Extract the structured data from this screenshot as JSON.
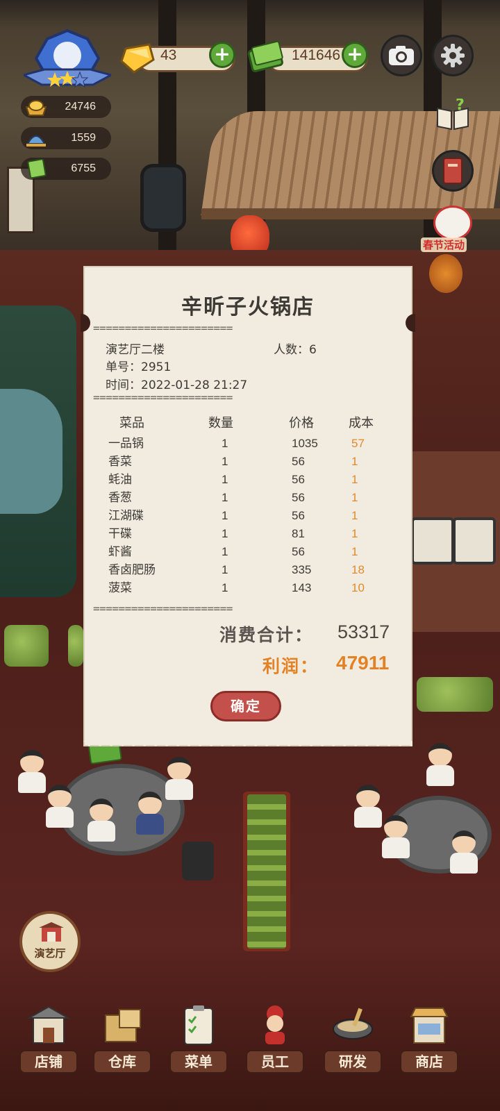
{
  "hud": {
    "gems": "43",
    "cash": "141646",
    "stats": [
      {
        "icon": "gold-ingot-icon",
        "value": "24746"
      },
      {
        "icon": "service-bell-icon",
        "value": "1559"
      },
      {
        "icon": "recipe-book-icon",
        "value": "6755"
      }
    ],
    "stars": 2,
    "stars_max": 3
  },
  "event_badge": "春节活动",
  "receipt": {
    "title": "辛昕子火锅店",
    "divider": "======================",
    "hall": "演艺厅二楼",
    "people": "人数：6",
    "order_no": "单号：2951",
    "time": "时间：2022-01-28 21:27",
    "columns": [
      "菜品",
      "数量",
      "价格",
      "成本"
    ],
    "items": [
      {
        "name": "一品锅",
        "qty": "1",
        "price": "1035",
        "cost": "57"
      },
      {
        "name": "香菜",
        "qty": "1",
        "price": "56",
        "cost": "1"
      },
      {
        "name": "蚝油",
        "qty": "1",
        "price": "56",
        "cost": "1"
      },
      {
        "name": "香葱",
        "qty": "1",
        "price": "56",
        "cost": "1"
      },
      {
        "name": "江湖碟",
        "qty": "1",
        "price": "56",
        "cost": "1"
      },
      {
        "name": "干碟",
        "qty": "1",
        "price": "81",
        "cost": "1"
      },
      {
        "name": "虾酱",
        "qty": "1",
        "price": "56",
        "cost": "1"
      },
      {
        "name": "香卤肥肠",
        "qty": "1",
        "price": "335",
        "cost": "18"
      },
      {
        "name": "菠菜",
        "qty": "1",
        "price": "143",
        "cost": "10"
      }
    ],
    "total_label": "消费合计：",
    "total_value": "53317",
    "profit_label": "利润：",
    "profit_value": "47911",
    "confirm": "确定"
  },
  "hall_button": "演艺厅",
  "nav": [
    "店铺",
    "仓库",
    "菜单",
    "员工",
    "研发",
    "商店"
  ],
  "colors": {
    "accent_orange": "#e38225",
    "button_red": "#c3504b",
    "plus_green": "#5fa83a"
  }
}
